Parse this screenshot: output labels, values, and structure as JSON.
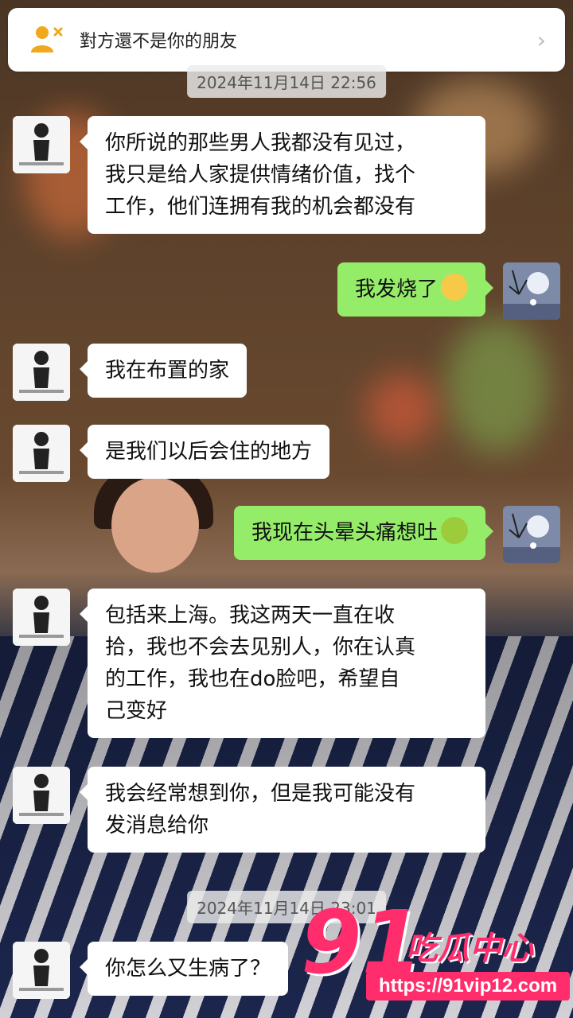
{
  "header": {
    "title": "對方還不是你的朋友",
    "icon": "person-not-friend-icon"
  },
  "timestamp_top": "2024年11月14日 22:56",
  "timestamp_bottom": "2024年11月14日 23:01",
  "messages": [
    {
      "side": "in",
      "text": "你所说的那些男人我都没有见过，\n我只是给人家提供情绪价值，找个\n工作，他们连拥有我的机会都没有"
    },
    {
      "side": "out",
      "text": "我发烧了",
      "emoji": "sick-face-emoji"
    },
    {
      "side": "in",
      "text": "我在布置的家"
    },
    {
      "side": "in",
      "text": "是我们以后会住的地方"
    },
    {
      "side": "out",
      "text": "我现在头晕头痛想吐",
      "emoji": "nauseated-face-emoji"
    },
    {
      "side": "in",
      "text": "包括来上海。我这两天一直在收\n拾，我也不会去见别人，你在认真\n的工作，我也在do脸吧，希望自\n己变好"
    },
    {
      "side": "in",
      "text": "我会经常想到你，但是我可能没有\n发消息给你"
    },
    {
      "side": "in",
      "text": "你怎么又生病了？"
    }
  ],
  "watermark": {
    "number": "91",
    "name": "吃瓜中心",
    "url": "https://91vip12.com"
  },
  "colors": {
    "incoming_bubble": "#ffffff",
    "outgoing_bubble": "#95ec69",
    "watermark": "#ff2d6b"
  }
}
